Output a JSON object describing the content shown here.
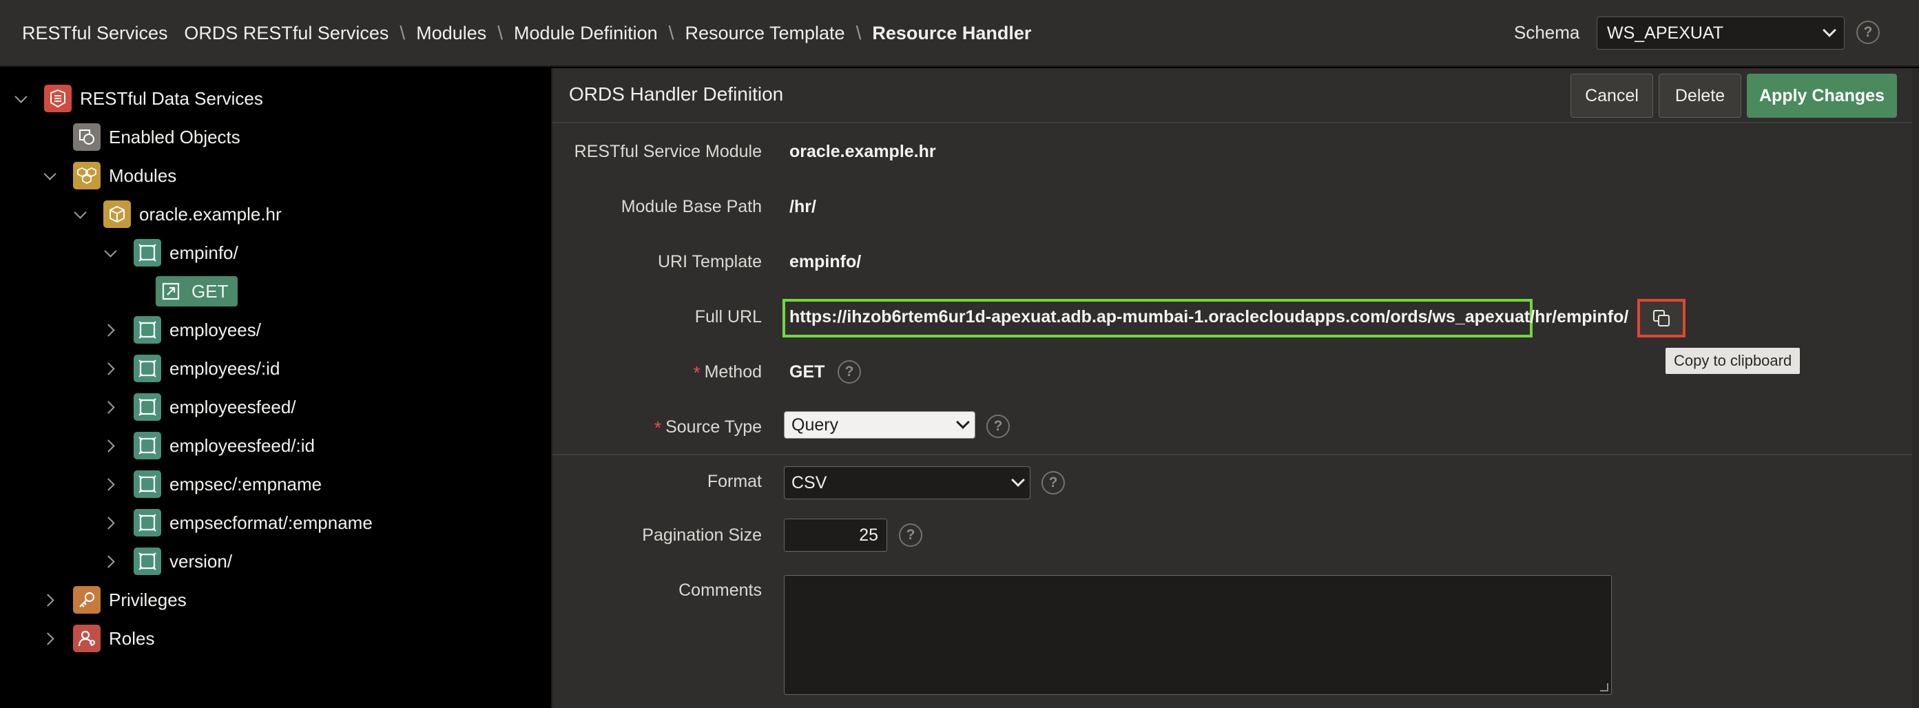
{
  "breadcrumb": [
    "RESTful Services",
    "ORDS RESTful Services",
    "Modules",
    "Module Definition",
    "Resource Template",
    "Resource Handler"
  ],
  "schema": {
    "label": "Schema",
    "value": "WS_APEXUAT",
    "help": "?"
  },
  "tree": {
    "root": "RESTful Data Services",
    "enabled_objects": "Enabled Objects",
    "modules": "Modules",
    "module_name": "oracle.example.hr",
    "templates": [
      "empinfo/",
      "employees/",
      "employees/:id",
      "employeesfeed/",
      "employeesfeed/:id",
      "empsec/:empname",
      "empsecformat/:empname",
      "version/"
    ],
    "handler": "GET",
    "privileges": "Privileges",
    "roles": "Roles"
  },
  "panel": {
    "title": "ORDS Handler Definition",
    "cancel": "Cancel",
    "delete": "Delete",
    "apply": "Apply Changes"
  },
  "form": {
    "module_label": "RESTful Service Module",
    "module_value": "oracle.example.hr",
    "base_path_label": "Module Base Path",
    "base_path_value": "/hr/",
    "uri_label": "URI Template",
    "uri_value": "empinfo/",
    "full_url_label": "Full URL",
    "full_url_value": "https://ihzob6rtem6ur1d-apexuat.adb.ap-mumbai-1.oraclecloudapps.com/ords/ws_apexuat/hr/empinfo/",
    "copy_tooltip": "Copy to clipboard",
    "method_label": "Method",
    "method_value": "GET",
    "source_type_label": "Source Type",
    "source_type_value": "Query",
    "format_label": "Format",
    "format_value": "CSV",
    "pagination_label": "Pagination Size",
    "pagination_value": "25",
    "comments_label": "Comments",
    "required_mark": "*",
    "help": "?"
  },
  "colors": {
    "apply": "#4a8a5c",
    "url_highlight": "#6fd93a",
    "copy_highlight": "#e0462f",
    "required": "#e5534b"
  }
}
